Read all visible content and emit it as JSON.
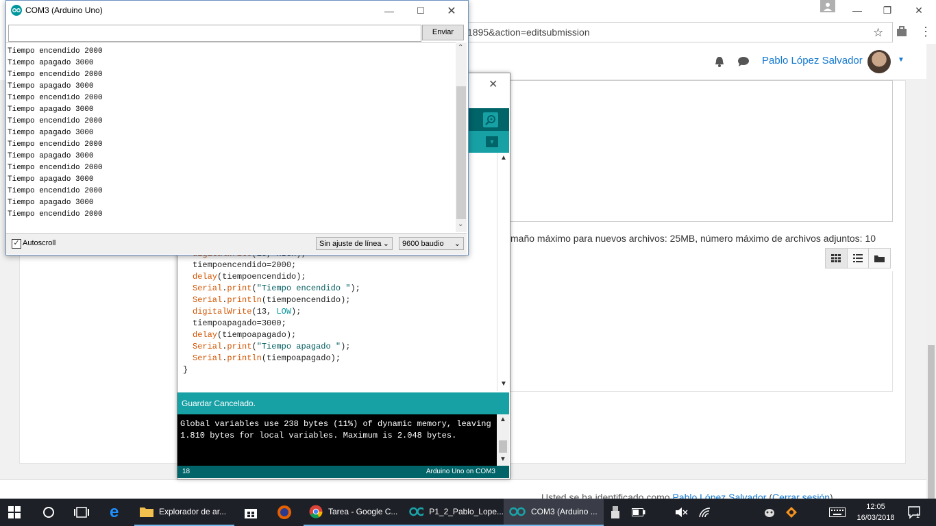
{
  "chrome": {
    "url_fragment": "1895&action=editsubmission",
    "user_name": "Pablo López Salvador",
    "files_note": "maño máximo para nuevos archivos: 25MB, número máximo de archivos adjuntos: 10",
    "footer_prefix": "Usted se ha identificado como ",
    "footer_user": "Pablo López Salvador",
    "footer_logout": "Cerrar sesión",
    "footer_paren_open": "(",
    "footer_paren_close": ")"
  },
  "serial_monitor": {
    "title": "COM3 (Arduino Uno)",
    "send_label": "Enviar",
    "input_value": "",
    "lines": [
      "Tiempo encendido 2000",
      "Tiempo apagado 3000",
      "Tiempo encendido 2000",
      "Tiempo apagado 3000",
      "Tiempo encendido 2000",
      "Tiempo apagado 3000",
      "Tiempo encendido 2000",
      "Tiempo apagado 3000",
      "Tiempo encendido 2000",
      "Tiempo apagado 3000",
      "Tiempo encendido 2000",
      "Tiempo apagado 3000",
      "Tiempo encendido 2000",
      "Tiempo apagado 3000",
      "Tiempo encendido 2000"
    ],
    "autoscroll_label": "Autoscroll",
    "autoscroll_checked": true,
    "line_ending": "Sin ajuste de línea",
    "baud": "9600 baudio"
  },
  "ide": {
    "code": {
      "l0_fn": "digitalWrite",
      "l0_rest": "(13, HIGH);",
      "l1": "tiempoencendido=2000;",
      "l2_fn": "delay",
      "l2_rest": "(tiempoencendido);",
      "l3_obj": "Serial",
      "l3_fn": "print",
      "l3_str": "\"Tiempo encendido \"",
      "l4_obj": "Serial",
      "l4_fn": "println",
      "l4_rest": "(tiempoencendido);",
      "l5_fn": "digitalWrite",
      "l5_a": "(13, ",
      "l5_const": "LOW",
      "l5_b": ");",
      "l6": "tiempoapagado=3000;",
      "l7_fn": "delay",
      "l7_rest": "(tiempoapagado);",
      "l8_obj": "Serial",
      "l8_fn": "print",
      "l8_str": "\"Tiempo apagado \"",
      "l9_obj": "Serial",
      "l9_fn": "println",
      "l9_rest": "(tiempoapagado);",
      "l10": "}"
    },
    "status_message": "Guardar Cancelado.",
    "console_line1": "Global variables use 238 bytes (11%) of dynamic memory, leaving",
    "console_line2": "1.810 bytes for local variables. Maximum is 2.048 bytes.",
    "line_number": "18",
    "board_port": "Arduino Uno on COM3"
  },
  "taskbar": {
    "apps": [
      {
        "label": "Explorador de ar...",
        "icon": "folder-icon"
      },
      {
        "label": "",
        "icon": "store-icon"
      },
      {
        "label": "",
        "icon": "firefox-icon"
      },
      {
        "label": "Tarea - Google C...",
        "icon": "chrome-icon"
      },
      {
        "label": "P1_2_Pablo_Lope...",
        "icon": "arduino-icon"
      },
      {
        "label": "COM3 (Arduino ...",
        "icon": "arduino-icon"
      }
    ],
    "time": "12:05",
    "date": "16/03/2018",
    "notification_count": "1"
  },
  "colors": {
    "arduino_dark": "#006468",
    "arduino_teal": "#17a1a5",
    "link_blue": "#1177d1",
    "taskbar": "#1e2028"
  }
}
